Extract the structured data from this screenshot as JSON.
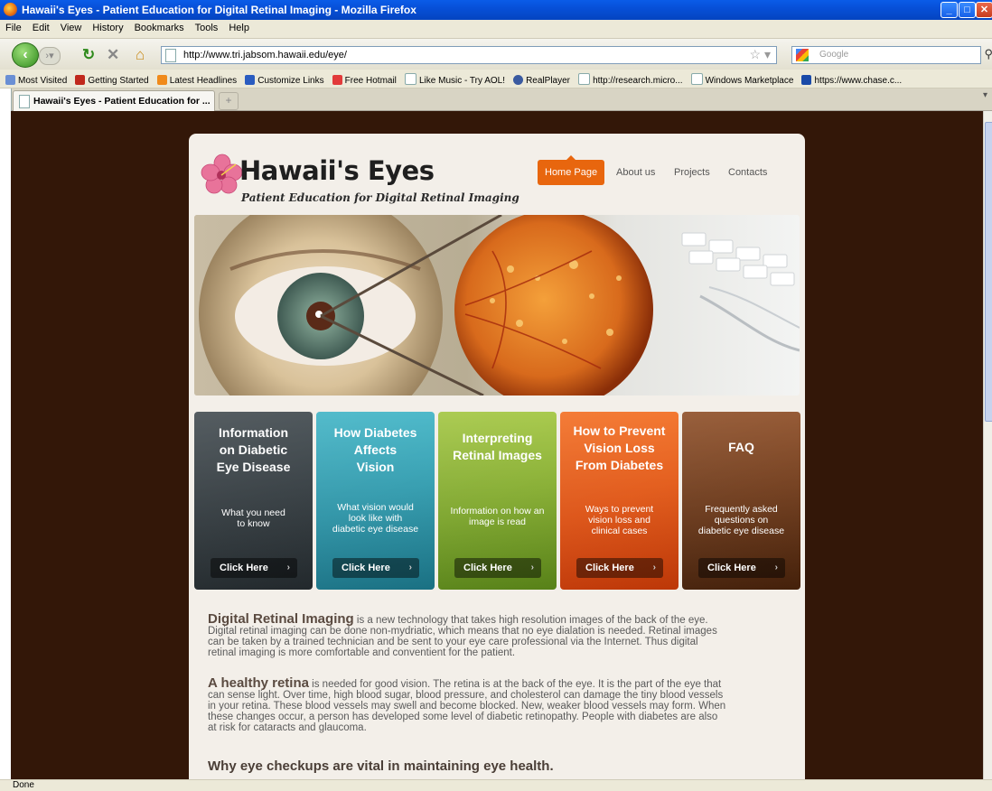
{
  "window": {
    "title": "Hawaii's Eyes - Patient Education for Digital Retinal Imaging - Mozilla Firefox"
  },
  "menu": [
    "File",
    "Edit",
    "View",
    "History",
    "Bookmarks",
    "Tools",
    "Help"
  ],
  "navbar": {
    "url": "http://www.tri.jabsom.hawaii.edu/eye/",
    "search_placeholder": "Google"
  },
  "bookmarks": [
    "Most Visited",
    "Getting Started",
    "Latest Headlines",
    "Customize Links",
    "Free Hotmail",
    "Like Music - Try AOL!",
    "RealPlayer",
    "http://research.micro...",
    "Windows Marketplace",
    "https://www.chase.c..."
  ],
  "tab": {
    "label": "Hawaii's Eyes - Patient Education for ..."
  },
  "status": "Done",
  "site": {
    "title": "Hawaii's Eyes",
    "subtitle": "Patient Education for Digital Retinal Imaging",
    "nav": [
      "Home Page",
      "About us",
      "Projects",
      "Contacts"
    ]
  },
  "cards": [
    {
      "title_lines": [
        "Information",
        "on Diabetic",
        "Eye Disease"
      ],
      "desc_lines": [
        "What you need",
        "to know"
      ],
      "button": "Click Here"
    },
    {
      "title_lines": [
        "How Diabetes",
        "Affects",
        "Vision"
      ],
      "desc_lines": [
        "What vision would",
        "look like with",
        "diabetic eye disease"
      ],
      "button": "Click Here"
    },
    {
      "title_lines": [
        "Interpreting",
        "Retinal Images"
      ],
      "desc_lines": [
        "Information on how an",
        "image is read"
      ],
      "button": "Click Here"
    },
    {
      "title_lines": [
        "How to Prevent",
        "Vision Loss",
        "From Diabetes"
      ],
      "desc_lines": [
        "Ways to prevent",
        "vision loss and",
        "clinical cases"
      ],
      "button": "Click Here"
    },
    {
      "title_lines": [
        "FAQ"
      ],
      "desc_lines": [
        "Frequently asked",
        "questions on",
        "diabetic eye disease"
      ],
      "button": "Click Here"
    }
  ],
  "article": {
    "p1_lead": "Digital Retinal Imaging",
    "p1_lines": [
      " is a new technology that takes high resolution images of the back of the eye.",
      "Digital retinal imaging can be done non-mydriatic, which means that no eye dialation is needed. Retinal images",
      "can be taken by a trained technician and be sent to your eye care professional via the Internet. Thus digital",
      "retinal imaging is more comfortable and conventient for the patient."
    ],
    "p2_lead": "A healthy retina",
    "p2_lines": [
      " is needed for good vision. The retina is at the back of the eye. It is the part of the eye that",
      "can sense light. Over time, high blood sugar, blood pressure, and cholesterol can damage the tiny blood vessels",
      "in your retina. These blood vessels may swell and become blocked. New, weaker blood vessels may form. When",
      "these changes occur, a person has developed some level of diabetic retinopathy. People with diabetes are also",
      "at risk for cataracts and glaucoma."
    ],
    "h3": "Why eye checkups are vital in maintaining eye health."
  }
}
